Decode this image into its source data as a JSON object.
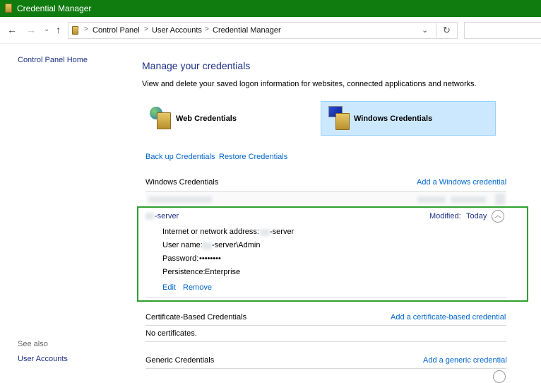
{
  "window": {
    "title": "Credential Manager"
  },
  "nav": {
    "back": "←",
    "forward": "→",
    "recent": "⌄",
    "up": "↑",
    "dropdown": "⌄",
    "refresh": "↻"
  },
  "breadcrumb": [
    "Control Panel",
    "User Accounts",
    "Credential Manager"
  ],
  "sidebar": {
    "home": "Control Panel Home",
    "see_also": "See also",
    "user_accounts": "User Accounts"
  },
  "main": {
    "title": "Manage your credentials",
    "description": "View and delete your saved logon information for websites, connected applications and networks.",
    "tiles": [
      {
        "label": "Web Credentials"
      },
      {
        "label": "Windows Credentials",
        "selected": true
      }
    ],
    "backup": "Back up Credentials",
    "restore": "Restore Credentials",
    "windows": {
      "heading": "Windows Credentials",
      "add": "Add a Windows credential",
      "item": {
        "name": "-server",
        "modified_label": "Modified:",
        "modified_value": "Today",
        "address_label": "Internet or network address:",
        "address_value": "-server",
        "user_label": "User name:",
        "user_value": "-server\\Admin",
        "password_label": "Password:",
        "password_value": "••••••••",
        "persistence_label": "Persistence:",
        "persistence_value": "Enterprise",
        "edit": "Edit",
        "remove": "Remove"
      }
    },
    "certificate": {
      "heading": "Certificate-Based Credentials",
      "add": "Add a certificate-based credential",
      "empty": "No certificates."
    },
    "generic": {
      "heading": "Generic Credentials",
      "add": "Add a generic credential"
    }
  },
  "colors": {
    "titlebar": "#107c10",
    "highlight": "#2ea02e",
    "link": "#0066cc",
    "selected_tile": "#cce8ff"
  }
}
